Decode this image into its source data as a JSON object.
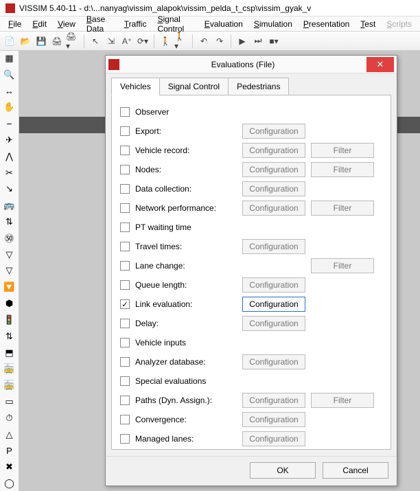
{
  "app_title": "VISSIM 5.40-11 - d:\\...nanyag\\vissim_alapok\\vissim_pelda_t_csp\\vissim_gyak_v",
  "menu": [
    "File",
    "Edit",
    "View",
    "Base Data",
    "Traffic",
    "Signal Control",
    "Evaluation",
    "Simulation",
    "Presentation",
    "Test",
    "Scripts"
  ],
  "menu_disabled_index": 10,
  "dialog": {
    "title": "Evaluations (File)",
    "tabs": [
      "Vehicles",
      "Signal Control",
      "Pedestrians"
    ],
    "active_tab": 0,
    "config_label": "Configuration",
    "filter_label": "Filter",
    "rows": [
      {
        "label": "Observer",
        "checked": false,
        "config": false,
        "filter": false
      },
      {
        "label": "Export:",
        "checked": false,
        "config": true,
        "filter": false
      },
      {
        "label": "Vehicle record:",
        "checked": false,
        "config": true,
        "filter": true
      },
      {
        "label": "Nodes:",
        "checked": false,
        "config": true,
        "filter": true
      },
      {
        "label": "Data collection:",
        "checked": false,
        "config": true,
        "filter": false
      },
      {
        "label": "Network performance:",
        "checked": false,
        "config": true,
        "filter": true
      },
      {
        "label": "PT waiting time",
        "checked": false,
        "config": false,
        "filter": false
      },
      {
        "label": "Travel times:",
        "checked": false,
        "config": true,
        "filter": false
      },
      {
        "label": "Lane change:",
        "checked": false,
        "config": false,
        "filter": true
      },
      {
        "label": "Queue length:",
        "checked": false,
        "config": true,
        "filter": false
      },
      {
        "label": "Link evaluation:",
        "checked": true,
        "config": true,
        "config_active": true,
        "filter": false
      },
      {
        "label": "Delay:",
        "checked": false,
        "config": true,
        "filter": false
      },
      {
        "label": "Vehicle inputs",
        "checked": false,
        "config": false,
        "filter": false
      },
      {
        "label": "Analyzer database:",
        "checked": false,
        "config": true,
        "filter": false
      },
      {
        "label": "Special evaluations",
        "checked": false,
        "config": false,
        "filter": false
      },
      {
        "label": "Paths (Dyn. Assign.):",
        "checked": false,
        "config": true,
        "filter": true
      },
      {
        "label": "Convergence:",
        "checked": false,
        "config": true,
        "filter": false
      },
      {
        "label": "Managed lanes:",
        "checked": false,
        "config": true,
        "filter": false
      }
    ],
    "ok_label": "OK",
    "cancel_label": "Cancel"
  },
  "lefttool_icons": [
    "▦",
    "🔍",
    "↔",
    "✋",
    "⎯",
    "✈",
    "⋀",
    "✂",
    "↘",
    "🚌",
    "⇅",
    "㊿",
    "▽",
    "▽",
    "🔽",
    "⬢",
    "🚦",
    "⇅",
    "⬒",
    "🚋",
    "🚋",
    "▭",
    "⏱",
    "△",
    "P",
    "✖",
    "◯"
  ],
  "toolbar_icons": [
    "📄",
    "📂",
    "💾",
    "🖨",
    "🖨▾",
    "|",
    "↖",
    "⇲",
    "A⁺",
    "⟳▾",
    "|",
    "🚶",
    "🚶▾",
    "|",
    "↶",
    "↷",
    "|",
    "▶",
    "⏭",
    "■▾"
  ],
  "colors": {
    "accent": "#2a72c8",
    "close": "#e04040"
  }
}
